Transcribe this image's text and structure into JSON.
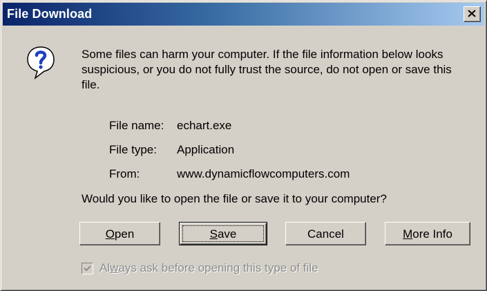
{
  "window": {
    "title": "File Download"
  },
  "message": {
    "warning": "Some files can harm your computer. If the file information below looks suspicious, or you do not fully trust the source, do not open or save this file."
  },
  "file_info": {
    "name_label": "File name:",
    "name_value": "echart.exe",
    "type_label": "File type:",
    "type_value": "Application",
    "from_label": "From:",
    "from_value": "www.dynamicflowcomputers.com"
  },
  "question": "Would you like to open the file or save it to your computer?",
  "buttons": {
    "open_accel": "O",
    "open_rest": "pen",
    "save_accel": "S",
    "save_rest": "ave",
    "cancel": "Cancel",
    "more_accel": "M",
    "more_rest": "ore Info"
  },
  "checkbox": {
    "checked": true,
    "label_pre": "Al",
    "label_accel": "w",
    "label_post": "ays ask before opening this type of file"
  },
  "icons": {
    "close": "close-icon",
    "question": "question-icon",
    "check": "checkmark-icon"
  }
}
